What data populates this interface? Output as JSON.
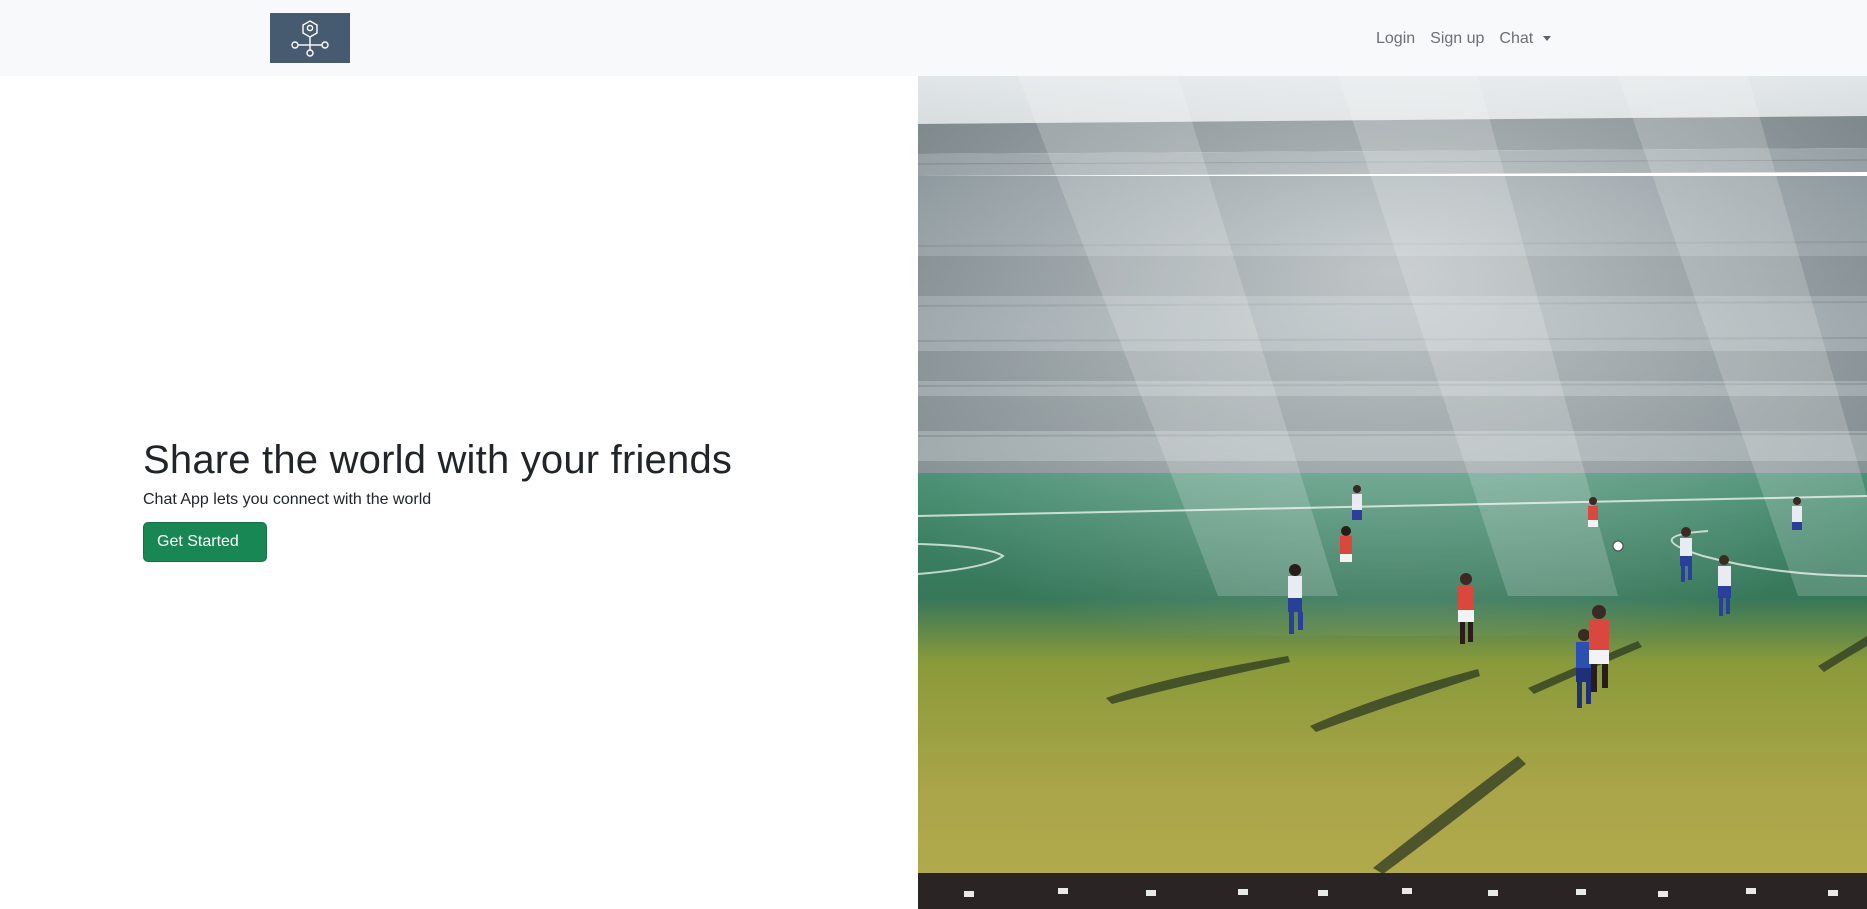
{
  "navbar": {
    "brand_icon": "network-nodes-icon",
    "links": {
      "login": "Login",
      "signup": "Sign up",
      "chat": "Chat"
    }
  },
  "hero": {
    "title": "Share the world with your friends",
    "subtitle": "Chat App lets you connect with the world",
    "cta_label": "Get Started"
  },
  "image": {
    "subject": "football-match-stadium-photo"
  },
  "colors": {
    "navbar_bg": "#f8f9fa",
    "brand_bg": "#465a70",
    "cta_bg": "#198754",
    "text": "#212529"
  }
}
